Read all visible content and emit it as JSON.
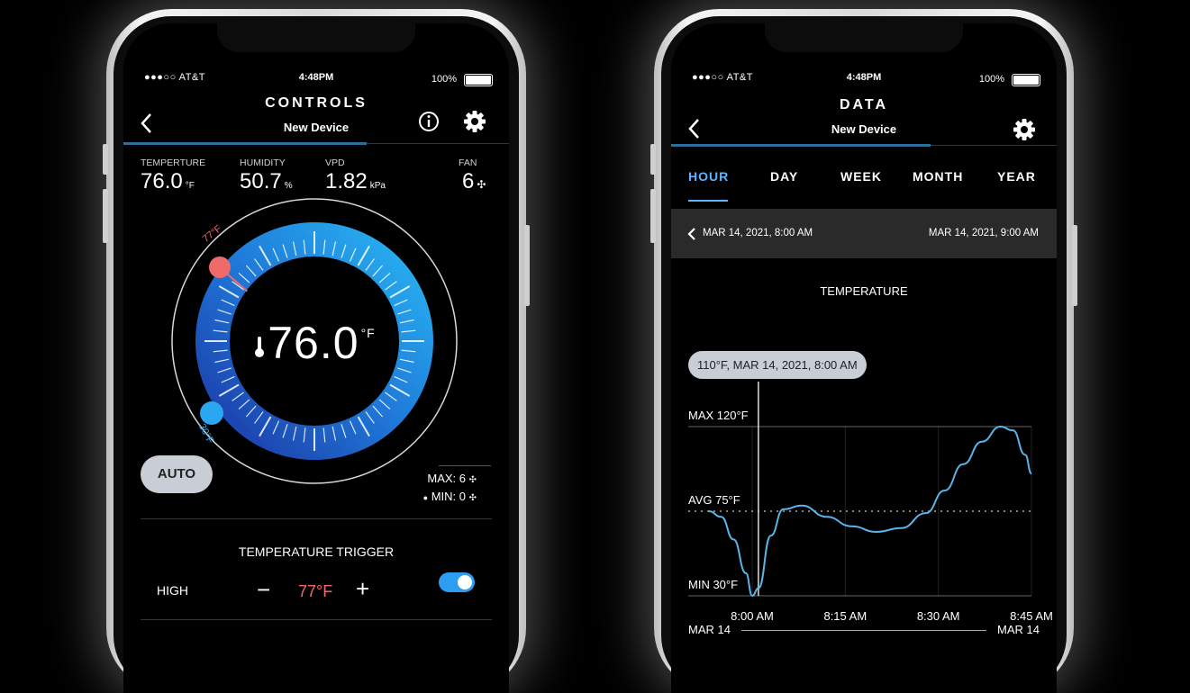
{
  "left_phone": {
    "status": {
      "carrier": "●●●○○ AT&T",
      "time": "4:48PM",
      "battery": "100%"
    },
    "header": {
      "title": "CONTROLS",
      "subtitle": "New Device"
    },
    "metrics": [
      {
        "label": "TEMPERTURE",
        "value": "76.0",
        "unit": "°F"
      },
      {
        "label": "HUMIDITY",
        "value": "50.7",
        "unit": "%"
      },
      {
        "label": "VPD",
        "value": "1.82",
        "unit": "kPa"
      },
      {
        "label": "FAN",
        "value": "6"
      }
    ],
    "dial": {
      "current_value": "76.0",
      "unit": "°F",
      "high_label": "77°F",
      "low_label": "30°F",
      "high_color": "#f06a6a",
      "low_color": "#2aa7f0"
    },
    "auto_label": "AUTO",
    "fan_max": "MAX: 6",
    "fan_min": "MIN: 0",
    "trigger": {
      "title": "TEMPERATURE TRIGGER",
      "row_label": "HIGH",
      "value": "77°F",
      "minus": "−",
      "plus": "+",
      "enabled": true
    }
  },
  "right_phone": {
    "status": {
      "carrier": "●●●○○ AT&T",
      "time": "4:48PM",
      "battery": "100%"
    },
    "header": {
      "title": "DATA",
      "subtitle": "New Device"
    },
    "tabs": [
      {
        "label": "HOUR",
        "active": true
      },
      {
        "label": "DAY",
        "active": false
      },
      {
        "label": "WEEK",
        "active": false
      },
      {
        "label": "MONTH",
        "active": false
      },
      {
        "label": "YEAR",
        "active": false
      }
    ],
    "range": {
      "start": "MAR 14, 2021, 8:00 AM",
      "end": "MAR 14, 2021, 9:00 AM"
    },
    "chart_title": "TEMPERATURE",
    "tooltip": "110°F, MAR 14, 2021, 8:00 AM",
    "footer_left": "MAR 14",
    "footer_right": "MAR 14"
  },
  "chart_data": {
    "type": "line",
    "title": "TEMPERATURE",
    "x_ticks": [
      "8:00 AM",
      "8:15 AM",
      "8:30 AM",
      "8:45 AM"
    ],
    "y_reference_labels": [
      "MAX 120°F",
      "AVG 75°F",
      "MIN 30°F"
    ],
    "ylim": [
      30,
      120
    ],
    "avg": 75,
    "series": [
      {
        "x": [
          "7:53 AM",
          "7:55 AM",
          "7:57 AM",
          "7:59 AM",
          "8:00 AM",
          "8:01 AM",
          "8:03 AM",
          "8:05 AM",
          "8:08 AM",
          "8:12 AM",
          "8:16 AM",
          "8:20 AM",
          "8:24 AM",
          "8:28 AM",
          "8:31 AM",
          "8:34 AM",
          "8:37 AM",
          "8:40 AM",
          "8:42 AM",
          "8:44 AM",
          "8:45 AM"
        ],
        "y": [
          75,
          72,
          60,
          42,
          30,
          34,
          62,
          76,
          78,
          72,
          67,
          64,
          66,
          74,
          86,
          100,
          112,
          120,
          118,
          105,
          95
        ]
      }
    ],
    "color": "#5bb4e8"
  }
}
